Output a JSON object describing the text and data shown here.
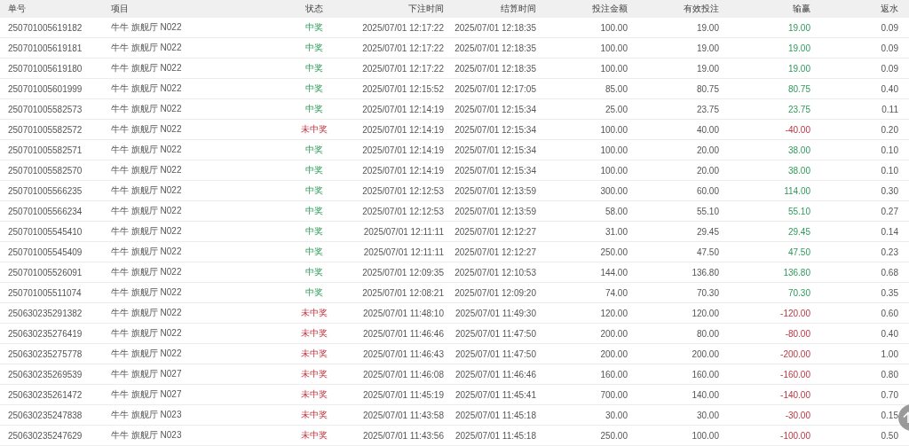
{
  "table": {
    "columns": [
      "单号",
      "项目",
      "状态",
      "下注时间",
      "结算时间",
      "投注金额",
      "有效投注",
      "输赢",
      "返水"
    ],
    "rows": [
      {
        "id": "250701005619182",
        "game": "牛牛 旗舰厅 N022",
        "status": "中奖",
        "win": true,
        "bet_time": "2025/07/01 12:17:22",
        "settle_time": "2025/07/01 12:18:35",
        "amount": "100.00",
        "valid": "19.00",
        "profit": "19.00",
        "rebate": "0.09"
      },
      {
        "id": "250701005619181",
        "game": "牛牛 旗舰厅 N022",
        "status": "中奖",
        "win": true,
        "bet_time": "2025/07/01 12:17:22",
        "settle_time": "2025/07/01 12:18:35",
        "amount": "100.00",
        "valid": "19.00",
        "profit": "19.00",
        "rebate": "0.09"
      },
      {
        "id": "250701005619180",
        "game": "牛牛 旗舰厅 N022",
        "status": "中奖",
        "win": true,
        "bet_time": "2025/07/01 12:17:22",
        "settle_time": "2025/07/01 12:18:35",
        "amount": "100.00",
        "valid": "19.00",
        "profit": "19.00",
        "rebate": "0.09"
      },
      {
        "id": "250701005601999",
        "game": "牛牛 旗舰厅 N022",
        "status": "中奖",
        "win": true,
        "bet_time": "2025/07/01 12:15:52",
        "settle_time": "2025/07/01 12:17:05",
        "amount": "85.00",
        "valid": "80.75",
        "profit": "80.75",
        "rebate": "0.40"
      },
      {
        "id": "250701005582573",
        "game": "牛牛 旗舰厅 N022",
        "status": "中奖",
        "win": true,
        "bet_time": "2025/07/01 12:14:19",
        "settle_time": "2025/07/01 12:15:34",
        "amount": "25.00",
        "valid": "23.75",
        "profit": "23.75",
        "rebate": "0.11"
      },
      {
        "id": "250701005582572",
        "game": "牛牛 旗舰厅 N022",
        "status": "未中奖",
        "win": false,
        "bet_time": "2025/07/01 12:14:19",
        "settle_time": "2025/07/01 12:15:34",
        "amount": "100.00",
        "valid": "40.00",
        "profit": "-40.00",
        "rebate": "0.20"
      },
      {
        "id": "250701005582571",
        "game": "牛牛 旗舰厅 N022",
        "status": "中奖",
        "win": true,
        "bet_time": "2025/07/01 12:14:19",
        "settle_time": "2025/07/01 12:15:34",
        "amount": "100.00",
        "valid": "20.00",
        "profit": "38.00",
        "rebate": "0.10"
      },
      {
        "id": "250701005582570",
        "game": "牛牛 旗舰厅 N022",
        "status": "中奖",
        "win": true,
        "bet_time": "2025/07/01 12:14:19",
        "settle_time": "2025/07/01 12:15:34",
        "amount": "100.00",
        "valid": "20.00",
        "profit": "38.00",
        "rebate": "0.10"
      },
      {
        "id": "250701005566235",
        "game": "牛牛 旗舰厅 N022",
        "status": "中奖",
        "win": true,
        "bet_time": "2025/07/01 12:12:53",
        "settle_time": "2025/07/01 12:13:59",
        "amount": "300.00",
        "valid": "60.00",
        "profit": "114.00",
        "rebate": "0.30"
      },
      {
        "id": "250701005566234",
        "game": "牛牛 旗舰厅 N022",
        "status": "中奖",
        "win": true,
        "bet_time": "2025/07/01 12:12:53",
        "settle_time": "2025/07/01 12:13:59",
        "amount": "58.00",
        "valid": "55.10",
        "profit": "55.10",
        "rebate": "0.27"
      },
      {
        "id": "250701005545410",
        "game": "牛牛 旗舰厅 N022",
        "status": "中奖",
        "win": true,
        "bet_time": "2025/07/01 12:11:11",
        "settle_time": "2025/07/01 12:12:27",
        "amount": "31.00",
        "valid": "29.45",
        "profit": "29.45",
        "rebate": "0.14"
      },
      {
        "id": "250701005545409",
        "game": "牛牛 旗舰厅 N022",
        "status": "中奖",
        "win": true,
        "bet_time": "2025/07/01 12:11:11",
        "settle_time": "2025/07/01 12:12:27",
        "amount": "250.00",
        "valid": "47.50",
        "profit": "47.50",
        "rebate": "0.23"
      },
      {
        "id": "250701005526091",
        "game": "牛牛 旗舰厅 N022",
        "status": "中奖",
        "win": true,
        "bet_time": "2025/07/01 12:09:35",
        "settle_time": "2025/07/01 12:10:53",
        "amount": "144.00",
        "valid": "136.80",
        "profit": "136.80",
        "rebate": "0.68"
      },
      {
        "id": "250701005511074",
        "game": "牛牛 旗舰厅 N022",
        "status": "中奖",
        "win": true,
        "bet_time": "2025/07/01 12:08:21",
        "settle_time": "2025/07/01 12:09:20",
        "amount": "74.00",
        "valid": "70.30",
        "profit": "70.30",
        "rebate": "0.35"
      },
      {
        "id": "250630235291382",
        "game": "牛牛 旗舰厅 N022",
        "status": "未中奖",
        "win": false,
        "bet_time": "2025/07/01 11:48:10",
        "settle_time": "2025/07/01 11:49:30",
        "amount": "120.00",
        "valid": "120.00",
        "profit": "-120.00",
        "rebate": "0.60"
      },
      {
        "id": "250630235276419",
        "game": "牛牛 旗舰厅 N022",
        "status": "未中奖",
        "win": false,
        "bet_time": "2025/07/01 11:46:46",
        "settle_time": "2025/07/01 11:47:50",
        "amount": "200.00",
        "valid": "80.00",
        "profit": "-80.00",
        "rebate": "0.40"
      },
      {
        "id": "250630235275778",
        "game": "牛牛 旗舰厅 N022",
        "status": "未中奖",
        "win": false,
        "bet_time": "2025/07/01 11:46:43",
        "settle_time": "2025/07/01 11:47:50",
        "amount": "200.00",
        "valid": "200.00",
        "profit": "-200.00",
        "rebate": "1.00"
      },
      {
        "id": "250630235269539",
        "game": "牛牛 旗舰厅 N027",
        "status": "未中奖",
        "win": false,
        "bet_time": "2025/07/01 11:46:08",
        "settle_time": "2025/07/01 11:46:46",
        "amount": "160.00",
        "valid": "160.00",
        "profit": "-160.00",
        "rebate": "0.80"
      },
      {
        "id": "250630235261472",
        "game": "牛牛 旗舰厅 N027",
        "status": "未中奖",
        "win": false,
        "bet_time": "2025/07/01 11:45:19",
        "settle_time": "2025/07/01 11:45:41",
        "amount": "700.00",
        "valid": "140.00",
        "profit": "-140.00",
        "rebate": "0.70"
      },
      {
        "id": "250630235247838",
        "game": "牛牛 旗舰厅 N023",
        "status": "未中奖",
        "win": false,
        "bet_time": "2025/07/01 11:43:58",
        "settle_time": "2025/07/01 11:45:18",
        "amount": "30.00",
        "valid": "30.00",
        "profit": "-30.00",
        "rebate": "0.15"
      },
      {
        "id": "250630235247629",
        "game": "牛牛 旗舰厅 N023",
        "status": "未中奖",
        "win": false,
        "bet_time": "2025/07/01 11:43:56",
        "settle_time": "2025/07/01 11:45:18",
        "amount": "250.00",
        "valid": "100.00",
        "profit": "-100.00",
        "rebate": "0.50"
      }
    ]
  }
}
